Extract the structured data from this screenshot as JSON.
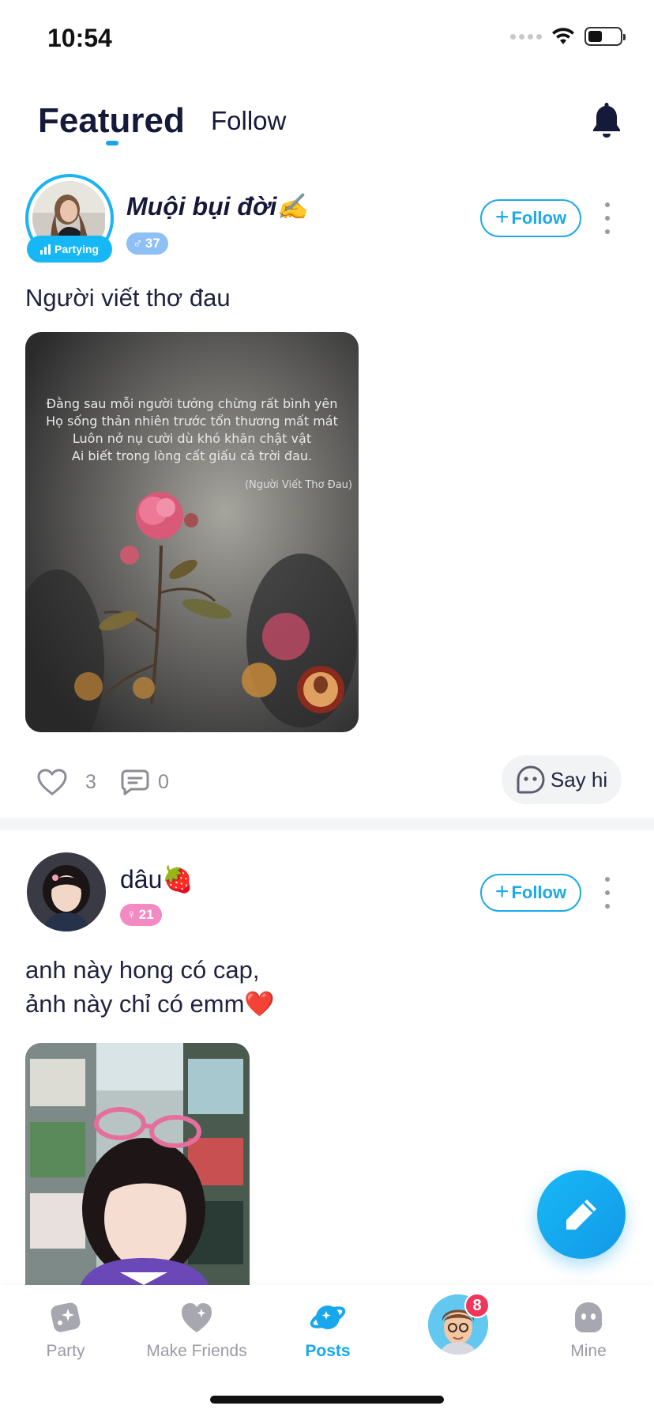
{
  "status_bar": {
    "time": "10:54",
    "battery_percent": 45
  },
  "header": {
    "tab_featured": "Featured",
    "tab_follow": "Follow",
    "bell_icon": "bell-icon"
  },
  "posts": [
    {
      "user_name": "Muội bụi đời✍️",
      "badge_label": "Partying",
      "gender": "male",
      "gender_symbol": "♂",
      "level": "37",
      "follow_label": "Follow",
      "text": "Người viết thơ đau",
      "image_poem": [
        "Đằng sau mỗi người tưởng chừng rất bình yên",
        "Họ sống thản nhiên trước tổn thương mất mát",
        "Luôn nở nụ cười dù khó khăn chật vật",
        "Ai biết trong lòng cất giấu cả trời đau."
      ],
      "image_credit": "(Người Viết Thơ Đau)",
      "likes": "3",
      "comments": "0",
      "say_hi_label": "Say hi"
    },
    {
      "user_name": "dâu🍓",
      "gender": "female",
      "gender_symbol": "♀",
      "level": "21",
      "follow_label": "Follow",
      "text_line1": "anh này hong có cap,",
      "text_line2": "ảnh này chỉ có emm❤️"
    }
  ],
  "bottom_nav": {
    "items": [
      {
        "label": "Party",
        "icon": "party-icon",
        "active": false
      },
      {
        "label": "Make Friends",
        "icon": "heart-icon",
        "active": false
      },
      {
        "label": "Posts",
        "icon": "planet-icon",
        "active": true
      },
      {
        "label": "",
        "icon": "avatar",
        "active": false
      },
      {
        "label": "Mine",
        "icon": "ghost-icon",
        "active": false
      }
    ],
    "badge_count": "8"
  },
  "colors": {
    "accent": "#1aa4ea",
    "badge_red": "#f0365a",
    "male_tag": "#8ec0f5",
    "female_tag": "#f48ac4"
  }
}
